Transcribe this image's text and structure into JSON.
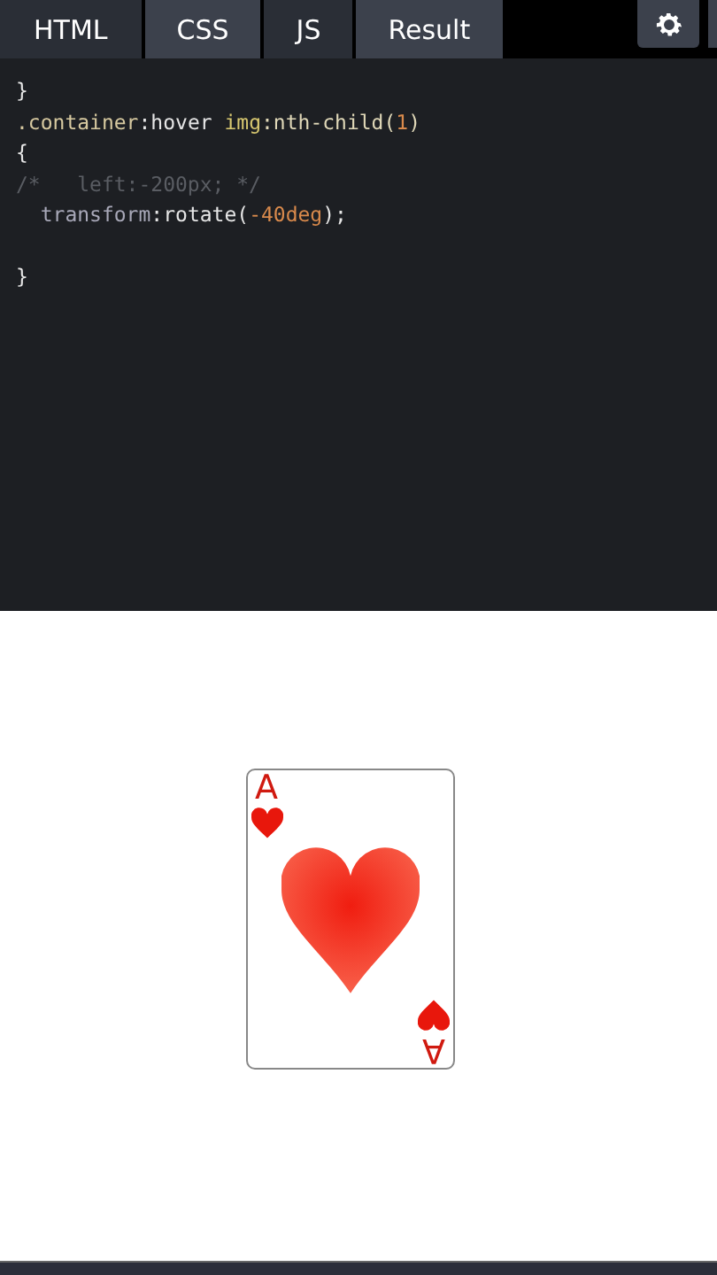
{
  "tabs": [
    {
      "label": "HTML",
      "selected": false
    },
    {
      "label": "CSS",
      "selected": true
    },
    {
      "label": "JS",
      "selected": false
    },
    {
      "label": "Result",
      "selected": true
    }
  ],
  "code_lines": [
    {
      "kind": "code",
      "tokens": [
        {
          "kind": "punct",
          "text": "}"
        }
      ]
    },
    {
      "kind": "code",
      "tokens": [
        {
          "kind": "selector",
          "text": ".container"
        },
        {
          "kind": "plain",
          "text": ":hover "
        },
        {
          "kind": "tag",
          "text": "img"
        },
        {
          "kind": "pseudo",
          "text": ":nth-child("
        },
        {
          "kind": "number",
          "text": "1"
        },
        {
          "kind": "pseudo",
          "text": ")"
        }
      ]
    },
    {
      "kind": "code",
      "tokens": [
        {
          "kind": "punct",
          "text": "{"
        }
      ]
    },
    {
      "kind": "code",
      "tokens": [
        {
          "kind": "comment",
          "text": "/*   left:-200px; */"
        }
      ]
    },
    {
      "kind": "code",
      "tokens": [
        {
          "kind": "property",
          "text": "  transform"
        },
        {
          "kind": "plain",
          "text": ":rotate("
        },
        {
          "kind": "number",
          "text": "-40deg"
        },
        {
          "kind": "plain",
          "text": ");"
        }
      ]
    },
    {
      "kind": "blank"
    },
    {
      "kind": "code",
      "tokens": [
        {
          "kind": "punct",
          "text": "}"
        }
      ]
    }
  ],
  "card": {
    "rank_top": "A",
    "rank_bottom": "A"
  }
}
